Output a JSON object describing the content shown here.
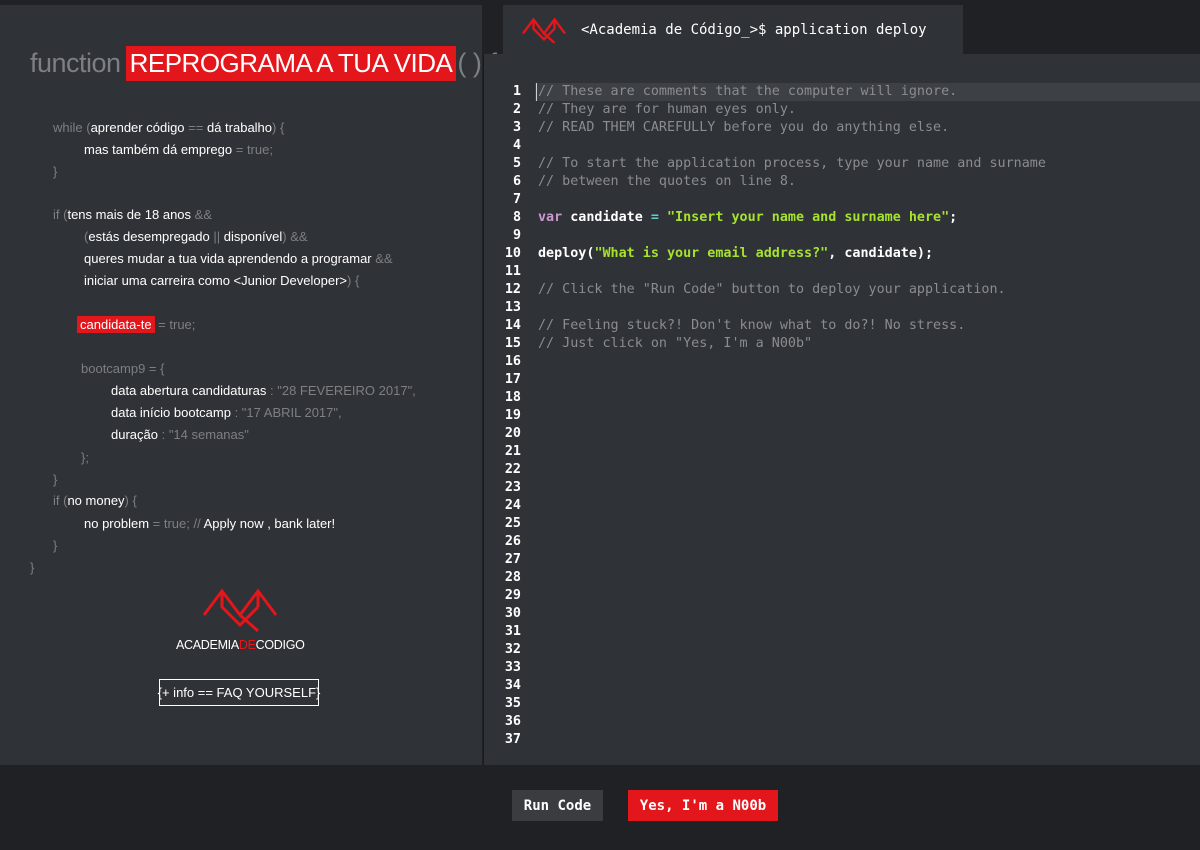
{
  "left_panel": {
    "heading": {
      "keyword": "function",
      "highlight": "REPROGRAMA A TUA VIDA",
      "tail": "( ) {"
    },
    "code": {
      "while_kw": "while (",
      "while_cond_a": "aprender código",
      "while_op": " == ",
      "while_cond_b": "dá trabalho",
      "while_close": ") {",
      "line2_a": "mas também dá emprego",
      "line2_b": " = true;",
      "close1": "}",
      "if_kw": "if (",
      "if_cond": "tens mais de 18 anos",
      "and": " &&",
      "paren_open": "(",
      "cond2_a": "estás desempregado",
      "or": " || ",
      "cond2_b": "disponível",
      "paren_close_and": ") &&",
      "cond3": "queres mudar a tua vida aprendendo a programar",
      "cond4": "iniciar uma carreira como <Junior Developer>",
      "cond4_close": ") {",
      "candidata": "candidata-te",
      "candidata_val": " = true;",
      "bootcamp": "bootcamp9 = {",
      "k1": "data abertura candidaturas",
      "v1": " : \"28 FEVEREIRO 2017\",",
      "k2": "data início bootcamp",
      "v2": " : \"17 ABRIL 2017\",",
      "k3": "duração",
      "v3": " : \"14 semanas\"",
      "obj_close": "};",
      "close2": "}",
      "if2_kw": "if (",
      "if2_cond": "no money",
      "if2_close": ") {",
      "np_a": "no problem",
      "np_b": " = true; // ",
      "np_c": "Apply now , bank later!",
      "close3": "}",
      "close4": "}"
    },
    "logo": {
      "part1": "ACADEMIA",
      "part2": "DE",
      "part3": "CODIGO",
      "icon": "academia-de-codigo-logo"
    },
    "faq_button": "{+ info == FAQ YOURSELF}"
  },
  "tab": {
    "title": "<Academia de Código_>$ application deploy",
    "icon": "academia-de-codigo-logo"
  },
  "editor": {
    "lines": [
      {
        "n": "1",
        "t": "// These are comments that the computer will ignore."
      },
      {
        "n": "2",
        "t": "// They are for human eyes only."
      },
      {
        "n": "3",
        "t": "// READ THEM CAREFULLY before you do anything else."
      },
      {
        "n": "4",
        "t": ""
      },
      {
        "n": "5",
        "t": "// To start the application process, type your name and surname"
      },
      {
        "n": "6",
        "t": "// between the quotes on line 8."
      },
      {
        "n": "7",
        "t": ""
      },
      {
        "n": "8",
        "t": ""
      },
      {
        "n": "9",
        "t": ""
      },
      {
        "n": "10",
        "t": ""
      },
      {
        "n": "11",
        "t": ""
      },
      {
        "n": "12",
        "t": "// Click the \"Run Code\" button to deploy your application."
      },
      {
        "n": "13",
        "t": ""
      },
      {
        "n": "14",
        "t": "// Feeling stuck?! Don't know what to do?! No stress."
      },
      {
        "n": "15",
        "t": "// Just click on \"Yes, I'm a N00b\""
      },
      {
        "n": "16",
        "t": ""
      },
      {
        "n": "17",
        "t": ""
      },
      {
        "n": "18",
        "t": ""
      },
      {
        "n": "19",
        "t": ""
      },
      {
        "n": "20",
        "t": ""
      },
      {
        "n": "21",
        "t": ""
      },
      {
        "n": "22",
        "t": ""
      },
      {
        "n": "23",
        "t": ""
      },
      {
        "n": "24",
        "t": ""
      },
      {
        "n": "25",
        "t": ""
      },
      {
        "n": "26",
        "t": ""
      },
      {
        "n": "27",
        "t": ""
      },
      {
        "n": "28",
        "t": ""
      },
      {
        "n": "29",
        "t": ""
      },
      {
        "n": "30",
        "t": ""
      },
      {
        "n": "31",
        "t": ""
      },
      {
        "n": "32",
        "t": ""
      },
      {
        "n": "33",
        "t": ""
      },
      {
        "n": "34",
        "t": ""
      },
      {
        "n": "35",
        "t": ""
      },
      {
        "n": "36",
        "t": ""
      },
      {
        "n": "37",
        "t": ""
      }
    ],
    "line8": {
      "kw": "var",
      "name": " candidate ",
      "op": "=",
      "sp": " ",
      "str": "\"Insert your name and surname here\"",
      "end": ";"
    },
    "line10": {
      "fn": "deploy(",
      "str": "\"What is your email address?\"",
      "rest": ", candidate);"
    }
  },
  "buttons": {
    "run": "Run Code",
    "noob": "Yes, I'm a N00b"
  },
  "colors": {
    "accent": "#e3161b",
    "panel": "#2f3236",
    "background": "#1f2124",
    "string": "#a6e22e",
    "keyword": "#cc99cd"
  }
}
